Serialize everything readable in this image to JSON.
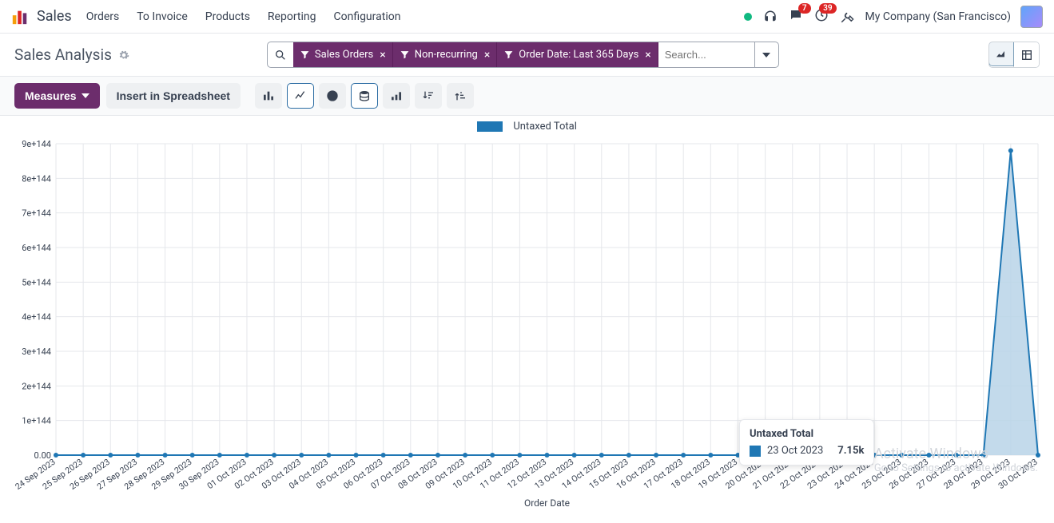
{
  "nav": {
    "app_title": "Sales",
    "links": [
      "Orders",
      "To Invoice",
      "Products",
      "Reporting",
      "Configuration"
    ],
    "company": "My Company (San Francisco)",
    "badges": {
      "chat": "7",
      "clock": "39"
    }
  },
  "header": {
    "title": "Sales Analysis",
    "filters": [
      {
        "label": "Sales Orders"
      },
      {
        "label": "Non-recurring"
      },
      {
        "label": "Order Date: Last 365 Days"
      }
    ],
    "search_placeholder": "Search..."
  },
  "toolbar": {
    "measures_label": "Measures",
    "spreadsheet_label": "Insert in Spreadsheet",
    "chart_types": [
      "bar",
      "line",
      "pie",
      "stacked",
      "bar-h",
      "sort-desc",
      "sort-asc"
    ],
    "active_type_indices": [
      1,
      3
    ]
  },
  "tooltip": {
    "title": "Untaxed Total",
    "date": "23 Oct 2023",
    "value": "7.15k"
  },
  "watermark": {
    "l1": "Activate Windows",
    "l2": "Go to Settings to activate Windows."
  },
  "chart_data": {
    "type": "line",
    "title": "",
    "legend": [
      "Untaxed Total"
    ],
    "xlabel": "Order Date",
    "ylabel": "",
    "ylim": [
      0,
      9e+144
    ],
    "y_ticks": [
      "0.00",
      "1e+144",
      "2e+144",
      "3e+144",
      "4e+144",
      "5e+144",
      "6e+144",
      "7e+144",
      "8e+144",
      "9e+144"
    ],
    "categories": [
      "24 Sep 2023",
      "25 Sep 2023",
      "26 Sep 2023",
      "27 Sep 2023",
      "28 Sep 2023",
      "29 Sep 2023",
      "30 Sep 2023",
      "01 Oct 2023",
      "02 Oct 2023",
      "03 Oct 2023",
      "04 Oct 2023",
      "05 Oct 2023",
      "06 Oct 2023",
      "07 Oct 2023",
      "08 Oct 2023",
      "09 Oct 2023",
      "10 Oct 2023",
      "11 Oct 2023",
      "12 Oct 2023",
      "13 Oct 2023",
      "14 Oct 2023",
      "15 Oct 2023",
      "16 Oct 2023",
      "17 Oct 2023",
      "18 Oct 2023",
      "19 Oct 2023",
      "20 Oct 2023",
      "21 Oct 2023",
      "22 Oct 2023",
      "23 Oct 2023",
      "24 Oct 2023",
      "25 Oct 2023",
      "26 Oct 2023",
      "27 Oct 2023",
      "28 Oct 2023",
      "29 Oct 2023",
      "30 Oct 2023"
    ],
    "series": [
      {
        "name": "Untaxed Total",
        "values": [
          0,
          0,
          0,
          0,
          0,
          0,
          0,
          0,
          0,
          0,
          0,
          0,
          0,
          0,
          0,
          0,
          0,
          0,
          0,
          0,
          0,
          0,
          0,
          0,
          0,
          0,
          0,
          0,
          0,
          0,
          0,
          0,
          0,
          0,
          0,
          8.8e+144,
          0
        ]
      }
    ],
    "note_point": {
      "index": 29,
      "display_value": "7.15k"
    }
  }
}
